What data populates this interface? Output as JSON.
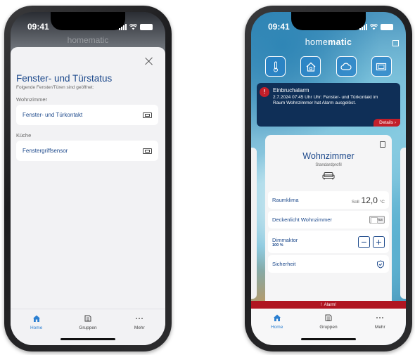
{
  "status": {
    "time": "09:41"
  },
  "left": {
    "bg_logo": "homematic",
    "title": "Fenster- und Türstatus",
    "subtitle": "Folgende Fenster/Türen sind geöffnet:",
    "sections": [
      {
        "name": "Wohnzimmer",
        "item": "Fenster- und Türkontakt"
      },
      {
        "name": "Küche",
        "item": "Fenstergriffsensor"
      }
    ]
  },
  "right": {
    "logo_a": "home",
    "logo_b": "matic",
    "quick_actions": [
      "thermometer-icon",
      "house-lock-icon",
      "cloud-icon",
      "window-icon"
    ],
    "alarm": {
      "title": "Einbruchalarm",
      "text": "2.7.2024 07:45 Uhr Uhr: Fenster- und Türkontakt im Raum Wohnzimmer hat Alarm ausgelöst.",
      "details": "Details"
    },
    "room": {
      "title": "Wohnzimmer",
      "profile": "Standardprofil",
      "raumklima_label": "Raumklima",
      "soll_label": "Soll",
      "soll_value": "12,0",
      "soll_unit": "°C",
      "light_label": "Deckenlicht Wohnzimmer",
      "light_state": "Aus",
      "dimm_label": "Dimmaktor",
      "dimm_value": "100 %",
      "security_label": "Sicherheit"
    },
    "alarm_strip": "Alarm!"
  },
  "tabs": [
    {
      "label": "Home",
      "icon": "home-icon"
    },
    {
      "label": "Gruppen",
      "icon": "groups-icon"
    },
    {
      "label": "Mehr",
      "icon": "more-icon"
    }
  ],
  "colors": {
    "accent": "#1e4a8c",
    "active_tab": "#2b7fd1",
    "alarm_red": "#c21f2a",
    "alarm_bg": "#0f2f57"
  }
}
